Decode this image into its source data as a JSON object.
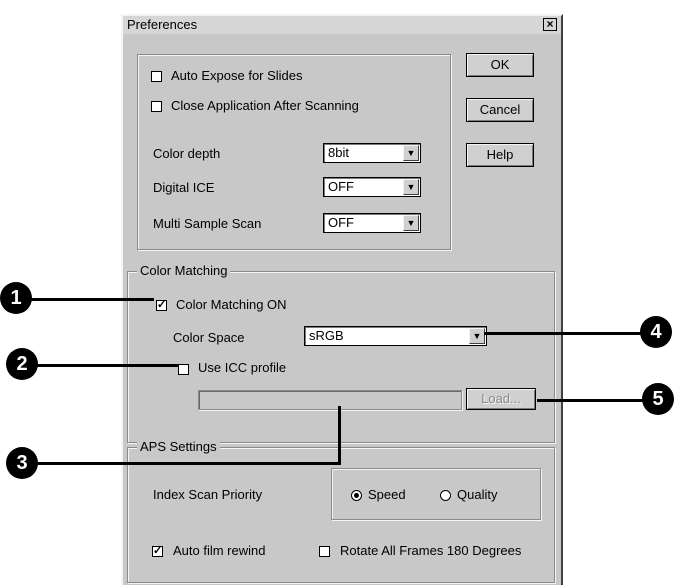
{
  "dialog": {
    "title": "Preferences",
    "close_glyph": "×"
  },
  "general": {
    "auto_expose": {
      "label": "Auto Expose for Slides",
      "checked": false
    },
    "close_app": {
      "label": "Close Application After Scanning",
      "checked": false
    },
    "color_depth": {
      "label": "Color depth",
      "value": "8bit"
    },
    "digital_ice": {
      "label": "Digital ICE",
      "value": "OFF"
    },
    "multi_sample": {
      "label": "Multi Sample Scan",
      "value": "OFF"
    }
  },
  "buttons": {
    "ok": "OK",
    "cancel": "Cancel",
    "help": "Help"
  },
  "color_matching": {
    "legend": "Color Matching",
    "on": {
      "label": "Color Matching ON",
      "checked": true,
      "check_glyph": "✓"
    },
    "color_space": {
      "label": "Color Space",
      "value": "sRGB"
    },
    "use_icc": {
      "label": "Use ICC profile",
      "checked": false
    },
    "icc_path": "",
    "load_label": "Load..."
  },
  "aps": {
    "legend": "APS Settings",
    "index_scan_priority": {
      "label": "Index Scan Priority",
      "options": [
        "Speed",
        "Quality"
      ],
      "selected": "Speed"
    },
    "auto_rewind": {
      "label": "Auto film rewind",
      "checked": true,
      "check_glyph": "✓"
    },
    "rotate_all": {
      "label": "Rotate All Frames 180 Degrees",
      "checked": false
    }
  },
  "callouts": [
    "1",
    "2",
    "3",
    "4",
    "5"
  ],
  "dropdown_glyph": "▼"
}
